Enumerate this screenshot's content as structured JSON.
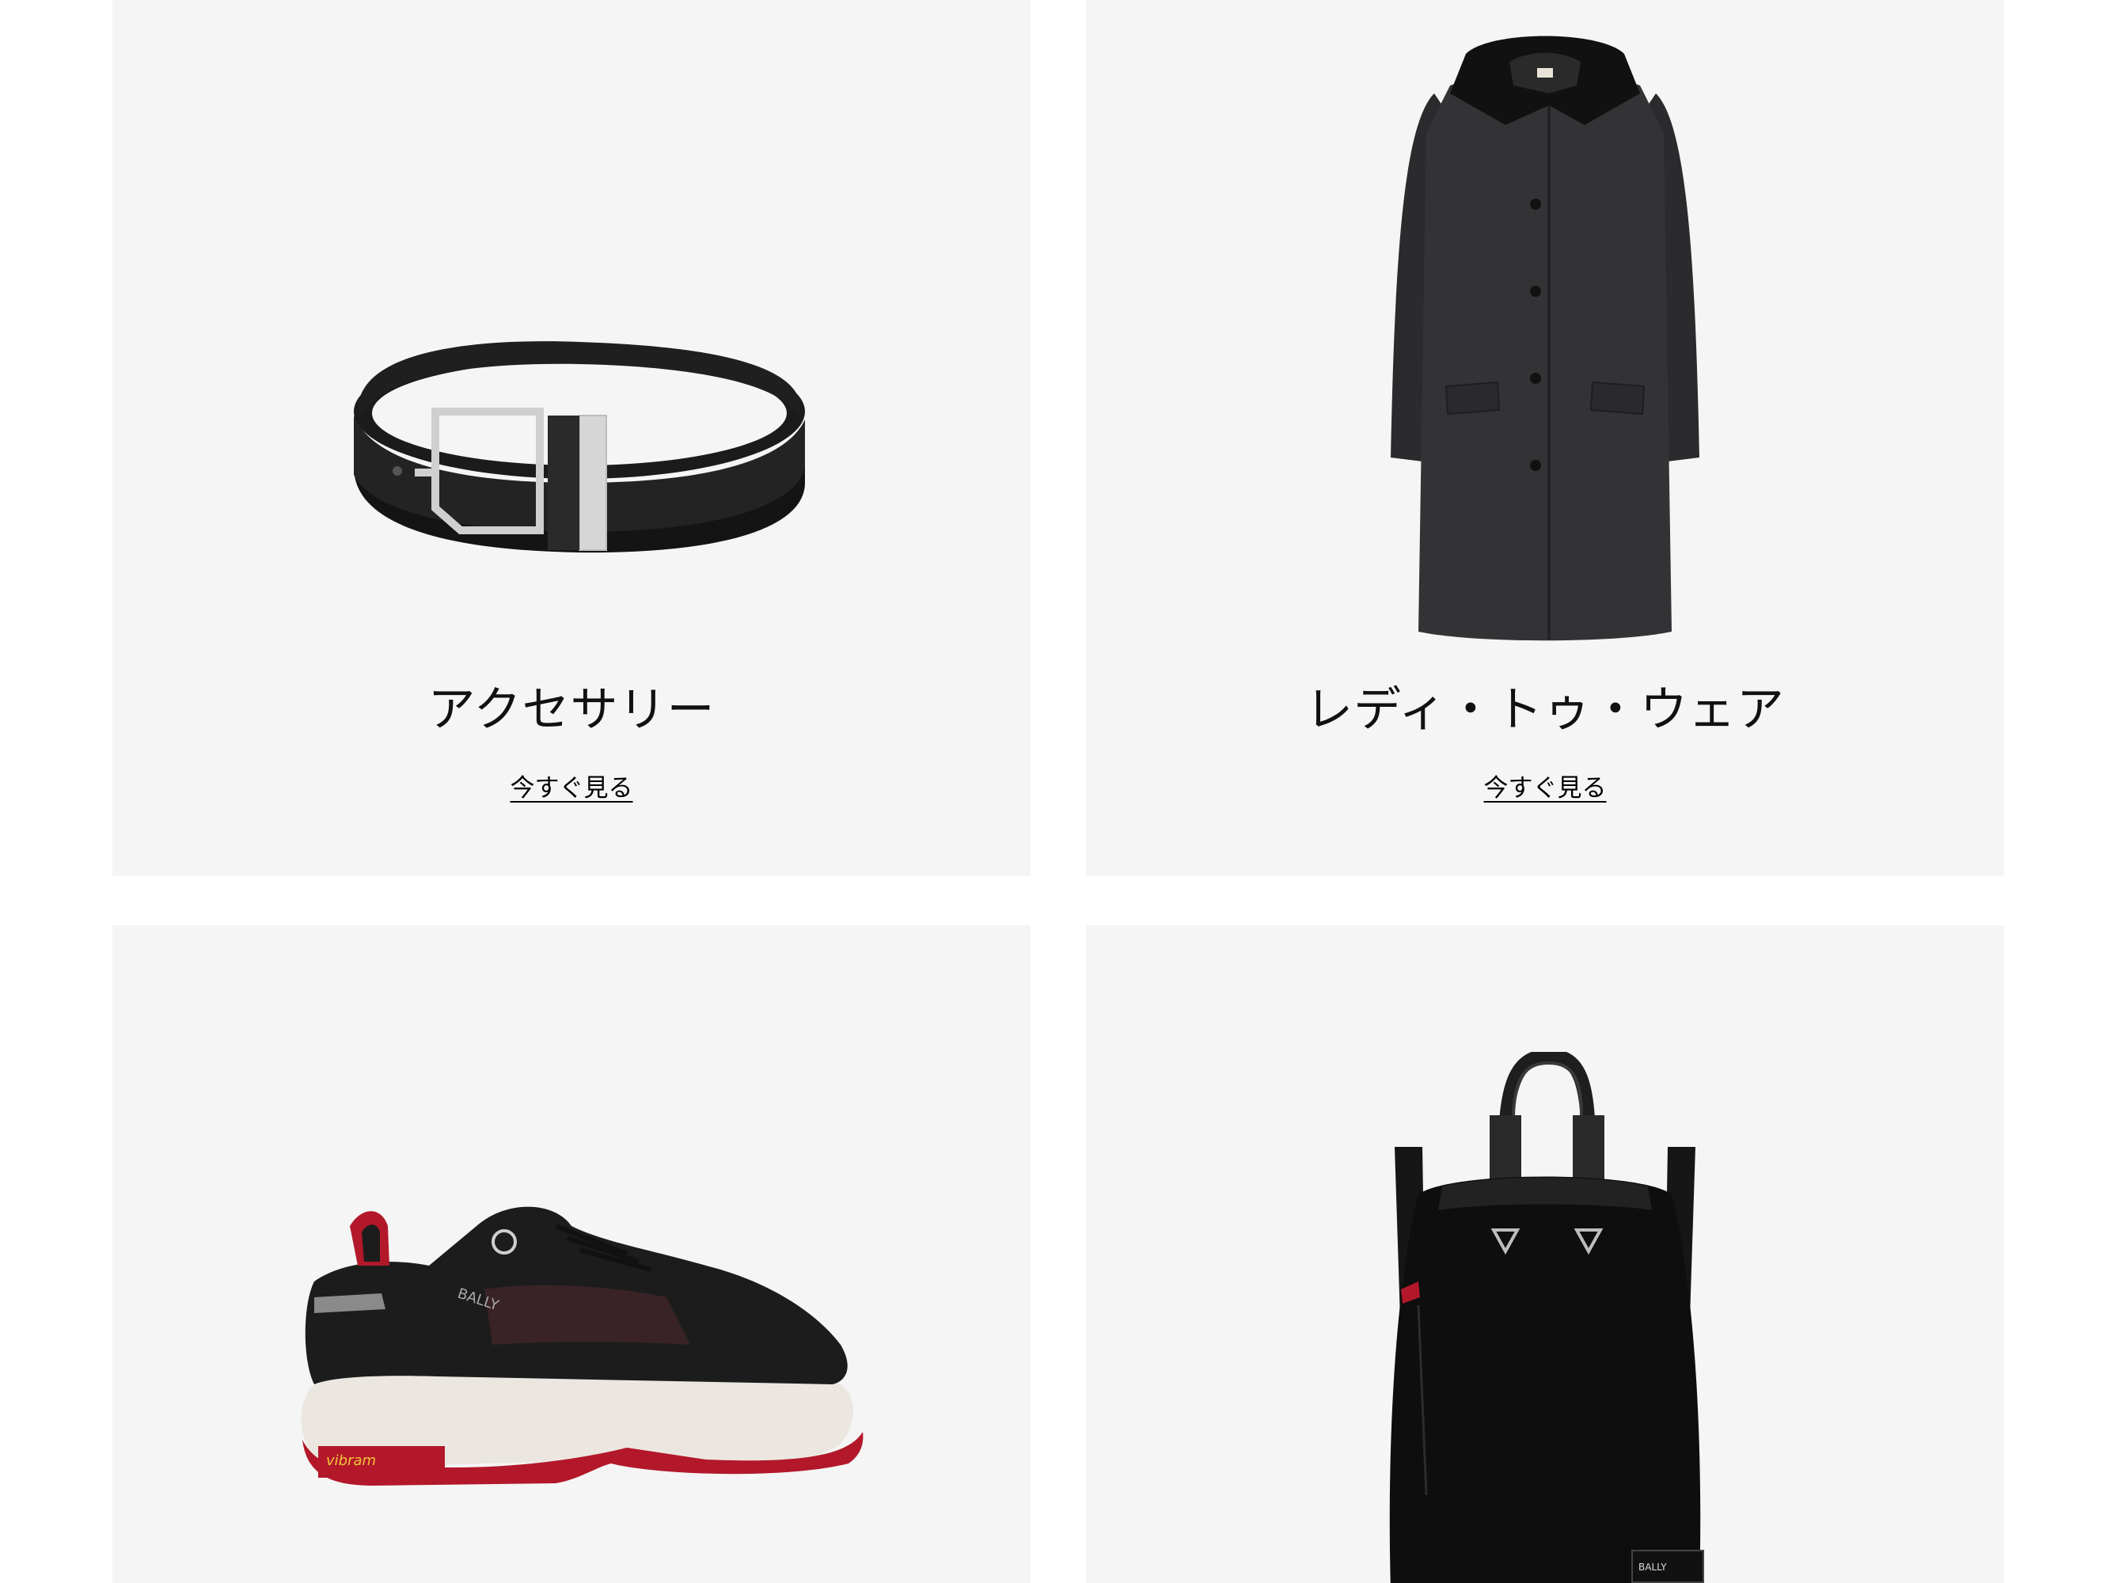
{
  "cards": [
    {
      "title": "アクセサリー",
      "link": "今すぐ見る",
      "image": "belt"
    },
    {
      "title": "レディ・トゥ・ウェア",
      "link": "今すぐ見る",
      "image": "coat"
    },
    {
      "title": "",
      "link": "",
      "image": "sneaker",
      "brand_text": "BALLY",
      "sole_text": "vibram"
    },
    {
      "title": "",
      "link": "",
      "image": "backpack",
      "brand_text": "BALLY"
    }
  ],
  "colors": {
    "card_background": "#f5f5f5",
    "page_background": "#ffffff",
    "text": "#111111",
    "accent_red": "#b3182a"
  }
}
